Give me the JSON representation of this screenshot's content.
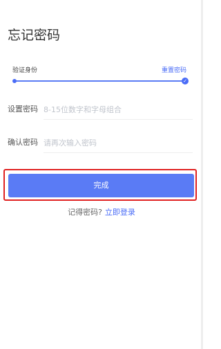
{
  "page": {
    "title": "忘记密码"
  },
  "steps": {
    "left_label": "验证身份",
    "right_label": "重置密码",
    "done_icon": "checkmark-icon"
  },
  "fields": {
    "password": {
      "label": "设置密码",
      "placeholder": "8-15位数字和字母组合",
      "value": ""
    },
    "confirm": {
      "label": "确认密码",
      "placeholder": "请再次输入密码",
      "value": ""
    }
  },
  "submit": {
    "label": "完成"
  },
  "footer": {
    "prompt": "记得密码?",
    "link": "立即登录"
  },
  "colors": {
    "accent": "#5a7bf5",
    "highlight": "#e02020"
  }
}
